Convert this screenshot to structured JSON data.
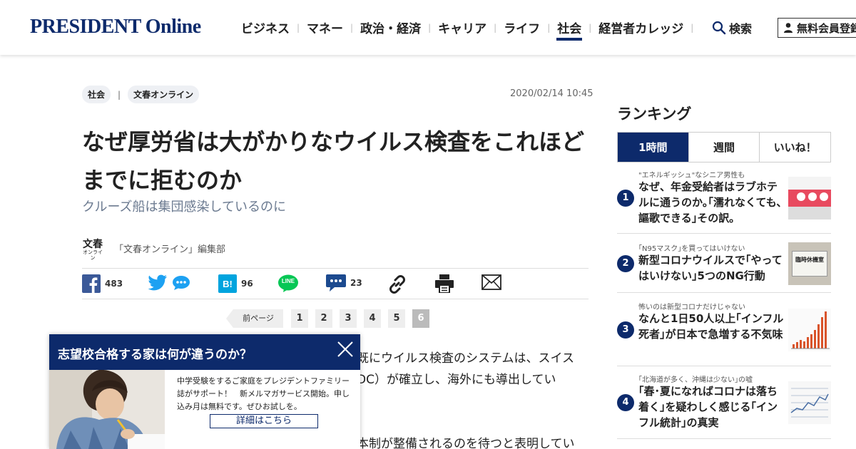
{
  "header": {
    "logo": "PRESIDENT Online",
    "nav": [
      "ビジネス",
      "マネー",
      "政治・経済",
      "キャリア",
      "ライフ",
      "社会",
      "経営者カレッジ"
    ],
    "active_nav": "社会",
    "search_label": "検索",
    "member_label": "無料会員登録",
    "brand_color": "#0d2a6b"
  },
  "article": {
    "tags": [
      "社会",
      "文春オンライン"
    ],
    "tag_separator": "|",
    "date": "2020/02/14 10:45",
    "title": "なぜ厚労省は大がかりなウイルス検査をこれほどまでに拒むのか",
    "subtitle": "クルーズ船は集団感染しているのに",
    "author_logo": "文春",
    "author_logo_sub": "オンライン",
    "author": "「文春オンライン」編集部",
    "share": {
      "facebook_count": "483",
      "hatena_label": "B!",
      "hatena_count": "96",
      "line_label": "LINE",
      "comments_count": "23"
    },
    "pager": {
      "prev_label": "前ページ",
      "pages": [
        "1",
        "2",
        "3",
        "4",
        "5",
        "6"
      ],
      "current": "6"
    },
    "body_lines": [
      "既にウイルス検査のシステムは、スイス",
      "DC）が確立し、海外にも導出してい",
      "本制が整備されるのを待つと表明してい"
    ]
  },
  "popup": {
    "title": "志望校合格する家は何が違うのか？",
    "text": "中学受験をするご家庭をプレジデントファミリー誌がサポート！　新メルマガサービス開始。申し込み月は無料です。ぜひお試しを。",
    "button": "詳細はこちら"
  },
  "sidebar": {
    "title": "ランキング",
    "tabs": [
      "1時間",
      "週間",
      "いいね！"
    ],
    "active_tab": "1時間",
    "items": [
      {
        "rank": "1",
        "kicker": "\"エネルギッシュ\"なシニア男性も",
        "headline": "なぜ、年金受給者はラブホテルに通うのか｡｢濡れなくても､謳歌できる｣その訳｡"
      },
      {
        "rank": "2",
        "kicker": "｢N95マスク｣を買ってはいけない",
        "headline": "新型コロナウイルスで｢やってはいけない｣5つのNG行動",
        "thumb_text": "臨時休機室"
      },
      {
        "rank": "3",
        "kicker": "怖いのは新型コロナだけじゃない",
        "headline": "なんと1日50人以上｢インフル死者｣が日本で急増する不気味"
      },
      {
        "rank": "4",
        "kicker": "｢北海道が多く、沖縄は少ない｣の嘘",
        "headline": "｢春･夏になればコロナは落ち着く｣を疑わしく感じる｢インフル統計｣の真実"
      }
    ]
  }
}
